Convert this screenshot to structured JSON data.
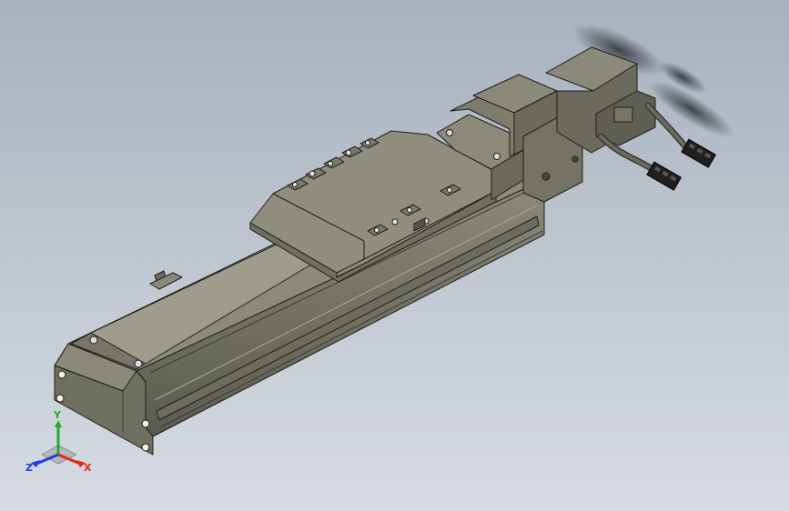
{
  "viewport": {
    "background_top": "#a7b1bd",
    "background_bottom": "#d7dce3"
  },
  "model": {
    "body_color": "#777666",
    "body_light": "#9a9988",
    "body_dark": "#4b4b40",
    "edge_color": "#1e1e1a",
    "cable_color": "#3a3a34",
    "connector_color": "#202020"
  },
  "triad": {
    "x_label": "X",
    "y_label": "Y",
    "z_label": "Z",
    "x_color": "#e8251b",
    "y_color": "#1fae2b",
    "z_color": "#1f3fe0"
  }
}
